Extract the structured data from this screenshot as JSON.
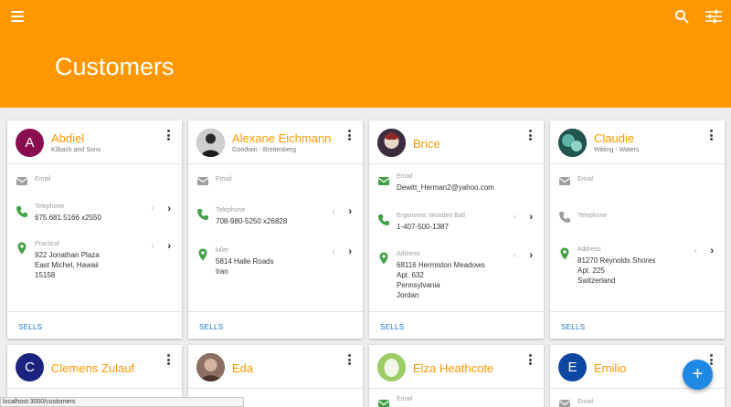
{
  "app": {
    "title": "Customers"
  },
  "status_url": "localhost:3000/customers",
  "colors": {
    "appbar": "#ff9800",
    "accent_name": "#ff9800",
    "icon_green": "#43a047",
    "link": "#1976d2",
    "fab": "#1e88e5"
  },
  "sells_label": "SELLS",
  "fab_label": "+",
  "cards": [
    {
      "initial": "A",
      "avatar_color": "#880e4f",
      "name": "Abdiel",
      "company": "Kilback and Sons",
      "rows": [
        {
          "icon": "email-icon",
          "label": "Email",
          "value": ""
        },
        {
          "icon": "phone-icon",
          "label": "Telephone",
          "value": "675.681.5166 x2550"
        },
        {
          "icon": "location-icon",
          "label": "Practical",
          "value": [
            "922 Jonathan Plaza",
            "East Michel, Hawaii",
            "15158"
          ]
        }
      ]
    },
    {
      "initial": "",
      "avatar_color": "#3a3a3a",
      "name": "Alexane Eichmann",
      "company": "Goodwin - Breitenberg",
      "rows": [
        {
          "icon": "email-icon",
          "label": "Email",
          "value": ""
        },
        {
          "icon": "phone-icon",
          "label": "Telephone",
          "value": "708-980-5250 x26828"
        },
        {
          "icon": "location-icon",
          "label": "killer",
          "value": [
            "5814 Halle Roads",
            "Iran"
          ]
        }
      ]
    },
    {
      "initial": "",
      "avatar_color": "#5a3d55",
      "name": "Brice",
      "company": "",
      "rows": [
        {
          "icon": "email-icon",
          "label": "Email",
          "value": "Dewitt_Herman2@yahoo.com"
        },
        {
          "icon": "phone-icon",
          "label": "Ergonomic Wooden Ball",
          "value": "1-407-500-1387"
        },
        {
          "icon": "location-icon",
          "label": "Address",
          "value": [
            "68116 Hermiston Meadows",
            "Apt. 632",
            "Pennsylvania",
            "Jordan"
          ]
        }
      ]
    },
    {
      "initial": "",
      "avatar_color": "#2f6f6a",
      "name": "Claudie",
      "company": "Witting - Waters",
      "rows": [
        {
          "icon": "email-icon",
          "label": "Email",
          "value": ""
        },
        {
          "icon": "phone-icon",
          "label": "Telephone",
          "value": ""
        },
        {
          "icon": "location-icon",
          "label": "Address",
          "value": [
            "81270 Reynolds Shores",
            "Apt. 225",
            "Switzerland"
          ]
        }
      ]
    },
    {
      "initial": "C",
      "avatar_color": "#1a237e",
      "name": "Clemens Zulauf",
      "company": ""
    },
    {
      "initial": "",
      "avatar_color": "#6d4c41",
      "name": "Eda",
      "company": ""
    },
    {
      "initial": "",
      "avatar_color": "#9ccc65",
      "name": "Elza Heathcote",
      "company": "",
      "first_row_label": "Email"
    },
    {
      "initial": "E",
      "avatar_color": "#0d47a1",
      "name": "Emilio",
      "company": "",
      "first_row_label": "Email"
    }
  ]
}
